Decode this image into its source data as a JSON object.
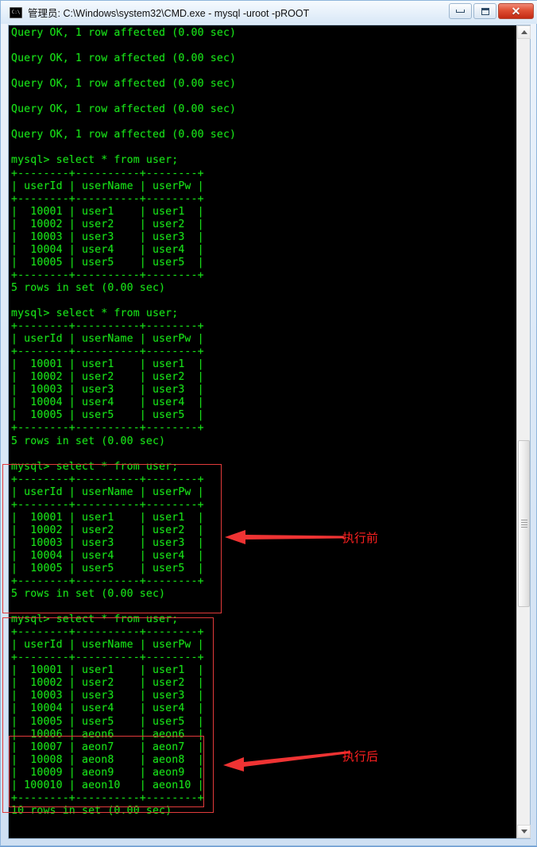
{
  "window": {
    "title": "管理员: C:\\Windows\\system32\\CMD.exe - mysql  -uroot -pROOT",
    "icon_label": "C:\\",
    "controls": {
      "minimize": "Minimize",
      "maximize": "Maximize",
      "close": "✕"
    }
  },
  "terminal": {
    "prompt": "mysql>",
    "command": "select * from user;",
    "colors": {
      "foreground": "#18e018",
      "background": "#000000"
    },
    "lines": [
      "Query OK, 1 row affected (0.00 sec)",
      "",
      "Query OK, 1 row affected (0.00 sec)",
      "",
      "Query OK, 1 row affected (0.00 sec)",
      "",
      "Query OK, 1 row affected (0.00 sec)",
      "",
      "Query OK, 1 row affected (0.00 sec)",
      "",
      "mysql> select * from user;",
      "+--------+----------+--------+",
      "| userId | userName | userPw |",
      "+--------+----------+--------+",
      "|  10001 | user1    | user1  |",
      "|  10002 | user2    | user2  |",
      "|  10003 | user3    | user3  |",
      "|  10004 | user4    | user4  |",
      "|  10005 | user5    | user5  |",
      "+--------+----------+--------+",
      "5 rows in set (0.00 sec)",
      "",
      "mysql> select * from user;",
      "+--------+----------+--------+",
      "| userId | userName | userPw |",
      "+--------+----------+--------+",
      "|  10001 | user1    | user1  |",
      "|  10002 | user2    | user2  |",
      "|  10003 | user3    | user3  |",
      "|  10004 | user4    | user4  |",
      "|  10005 | user5    | user5  |",
      "+--------+----------+--------+",
      "5 rows in set (0.00 sec)",
      "",
      "mysql> select * from user;",
      "+--------+----------+--------+",
      "| userId | userName | userPw |",
      "+--------+----------+--------+",
      "|  10001 | user1    | user1  |",
      "|  10002 | user2    | user2  |",
      "|  10003 | user3    | user3  |",
      "|  10004 | user4    | user4  |",
      "|  10005 | user5    | user5  |",
      "+--------+----------+--------+",
      "5 rows in set (0.00 sec)",
      "",
      "mysql> select * from user;",
      "+--------+----------+--------+",
      "| userId | userName | userPw |",
      "+--------+----------+--------+",
      "|  10001 | user1    | user1  |",
      "|  10002 | user2    | user2  |",
      "|  10003 | user3    | user3  |",
      "|  10004 | user4    | user4  |",
      "|  10005 | user5    | user5  |",
      "|  10006 | aeon6    | aeon6  |",
      "|  10007 | aeon7    | aeon7  |",
      "|  10008 | aeon8    | aeon8  |",
      "|  10009 | aeon9    | aeon9  |",
      "| 100010 | aeon10   | aeon10 |",
      "+--------+----------+--------+",
      "10 rows in set (0.00 sec)"
    ],
    "result_table": {
      "columns": [
        "userId",
        "userName",
        "userPw"
      ],
      "rows_before": [
        [
          "10001",
          "user1",
          "user1"
        ],
        [
          "10002",
          "user2",
          "user2"
        ],
        [
          "10003",
          "user3",
          "user3"
        ],
        [
          "10004",
          "user4",
          "user4"
        ],
        [
          "10005",
          "user5",
          "user5"
        ]
      ],
      "rows_added": [
        [
          "10006",
          "aeon6",
          "aeon6"
        ],
        [
          "10007",
          "aeon7",
          "aeon7"
        ],
        [
          "10008",
          "aeon8",
          "aeon8"
        ],
        [
          "10009",
          "aeon9",
          "aeon9"
        ],
        [
          "100010",
          "aeon10",
          "aeon10"
        ]
      ],
      "status_before": "5 rows in set (0.00 sec)",
      "status_after": "10 rows in set (0.00 sec)",
      "insert_status": "Query OK, 1 row affected (0.00 sec)"
    }
  },
  "annotations": {
    "color": "#ff2020",
    "before": {
      "label": "执行前"
    },
    "after": {
      "label": "执行后"
    }
  },
  "scrollbar": {
    "up_arrow": "▲",
    "down_arrow": "▼"
  }
}
